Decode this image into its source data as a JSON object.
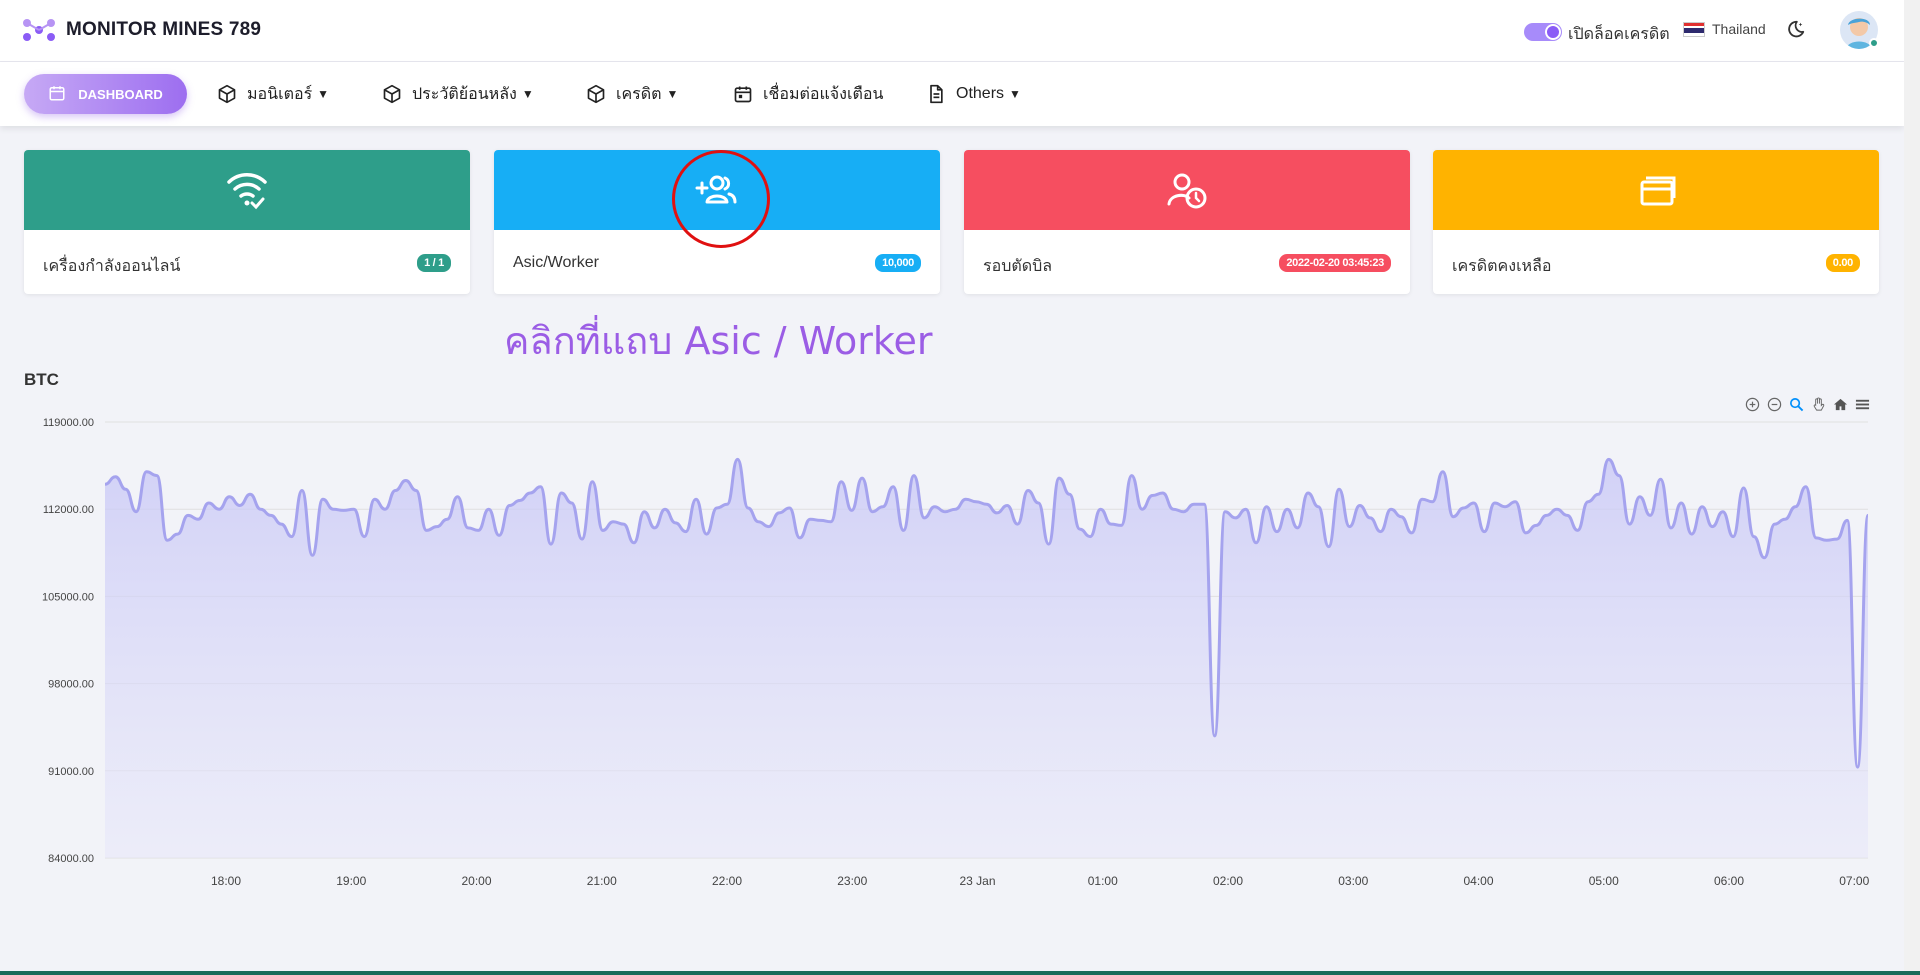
{
  "app": {
    "brand": "MONITOR MINES 789",
    "toggle_label": "เปิดล็อคเครดิต",
    "language": "Thailand"
  },
  "nav": {
    "dashboard": "DASHBOARD",
    "monitor": "มอนิเตอร์",
    "history": "ประวัติย้อนหลัง",
    "credit": "เครดิต",
    "notify": "เชื่อมต่อแจ้งเตือน",
    "others": "Others"
  },
  "cards": [
    {
      "label": "เครื่องกำลังออนไลน์",
      "badge": "1 / 1",
      "color": "#2e9e8a",
      "icon": "wifi-check-icon"
    },
    {
      "label": "Asic/Worker",
      "badge": "10,000",
      "color": "#17aef5",
      "icon": "user-plus-icon"
    },
    {
      "label": "รอบตัดบิล",
      "badge": "2022-02-20 03:45:23",
      "color": "#f64e60",
      "icon": "user-clock-icon"
    },
    {
      "label": "เครดิตคงเหลือ",
      "badge": "0.00",
      "color": "#ffb300",
      "icon": "cards-icon"
    }
  ],
  "annotation": "คลิกที่แถบ Asic / Worker",
  "chart_data": {
    "type": "area",
    "title": "BTC",
    "ylim": [
      84000,
      119000
    ],
    "yticks": [
      "119000.00",
      "112000.00",
      "105000.00",
      "98000.00",
      "91000.00",
      "84000.00"
    ],
    "xticks": [
      "18:00",
      "19:00",
      "20:00",
      "21:00",
      "22:00",
      "23:00",
      "23 Jan",
      "01:00",
      "02:00",
      "03:00",
      "04:00",
      "05:00",
      "06:00",
      "07:00"
    ],
    "color": "#a5a3ee",
    "grid": true,
    "values": [
      114000,
      114600,
      113600,
      111800,
      115000,
      114700,
      109500,
      110000,
      111500,
      111200,
      112500,
      112000,
      113000,
      112300,
      113200,
      112000,
      111500,
      110800,
      109800,
      113500,
      108300,
      112800,
      112000,
      111900,
      112000,
      109800,
      112800,
      112000,
      113500,
      114300,
      113500,
      110300,
      110600,
      111200,
      113000,
      110500,
      110300,
      112000,
      109900,
      112300,
      112700,
      113300,
      113800,
      109200,
      113300,
      112500,
      109600,
      114200,
      110300,
      111000,
      110800,
      109300,
      111800,
      110500,
      112000,
      110900,
      110200,
      112800,
      110000,
      112100,
      112400,
      116000,
      112100,
      111000,
      110600,
      111700,
      112100,
      109700,
      111200,
      111100,
      111000,
      114200,
      111900,
      114500,
      111800,
      112200,
      113800,
      110300,
      114700,
      111300,
      112200,
      111800,
      112000,
      112800,
      112600,
      112400,
      111700,
      112300,
      110800,
      113500,
      112500,
      109200,
      114500,
      113200,
      110400,
      109800,
      112000,
      110800,
      110700,
      114700,
      112000,
      113100,
      113300,
      112000,
      111800,
      112400,
      112400,
      93800,
      111800,
      111300,
      112000,
      109300,
      112200,
      110200,
      112000,
      110500,
      113300,
      112200,
      109000,
      113600,
      110600,
      112300,
      111300,
      110200,
      112000,
      111400,
      110100,
      112800,
      112600,
      115000,
      111400,
      112100,
      112500,
      110200,
      112500,
      112200,
      112600,
      110100,
      110700,
      111500,
      112000,
      111500,
      110300,
      112600,
      113200,
      116000,
      114700,
      110800,
      113000,
      111500,
      114400,
      110500,
      112500,
      110000,
      112200,
      110600,
      111800,
      109800,
      113700,
      109800,
      108100,
      110800,
      111200,
      112200,
      113800,
      109700,
      109500,
      109600,
      111100,
      91300,
      111500
    ]
  }
}
